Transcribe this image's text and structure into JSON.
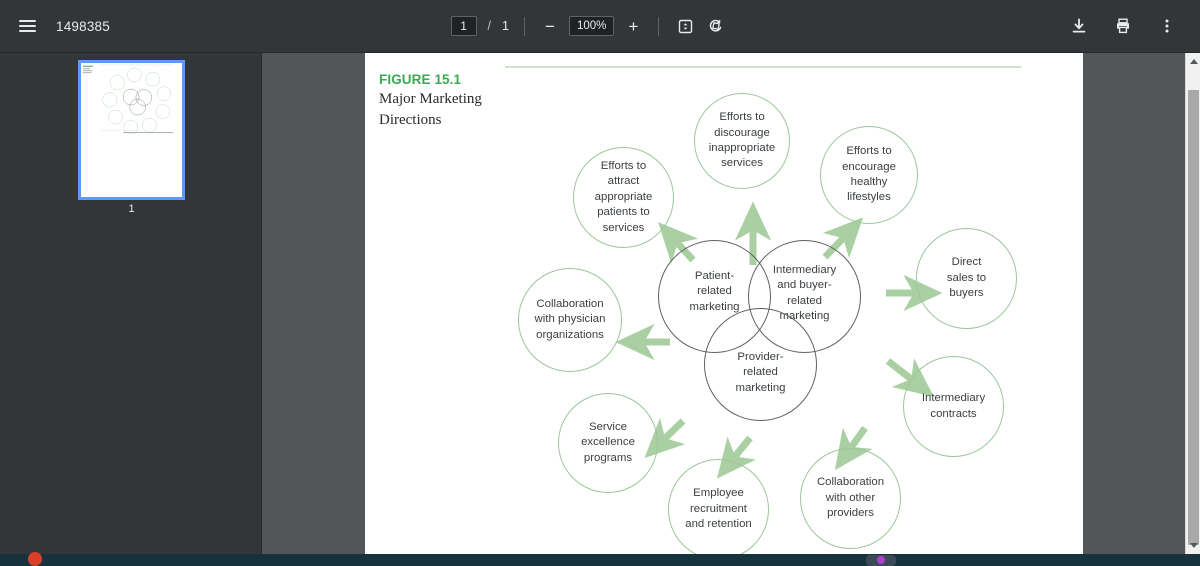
{
  "toolbar": {
    "menu_icon": "hamburger-menu-icon",
    "document_title": "1498385",
    "page_current": "1",
    "page_separator": "/",
    "page_total": "1",
    "zoom_out_label": "−",
    "zoom_level": "100%",
    "zoom_in_label": "+",
    "fit_page_icon": "fit-to-page-icon",
    "rotate_icon": "rotate-counterclockwise-icon",
    "download_icon": "download-icon",
    "print_icon": "print-icon",
    "more_icon": "more-options-icon"
  },
  "sidebar": {
    "thumbnails": [
      {
        "label": "1",
        "selected": true
      }
    ]
  },
  "document": {
    "figure_label": "FIGURE 15.1",
    "figure_title": "Major Marketing Directions",
    "core_circles": [
      {
        "id": "patient",
        "text": "Patient-\nrelated\nmarketing"
      },
      {
        "id": "intermediary",
        "text": "Intermediary\nand buyer-\nrelated\nmarketing"
      },
      {
        "id": "provider",
        "text": "Provider-\nrelated\nmarketing"
      }
    ],
    "outer_circles": [
      {
        "id": "discourage",
        "text": "Efforts to\ndiscourage\ninappropriate\nservices"
      },
      {
        "id": "encourage",
        "text": "Efforts to\nencourage\nhealthy\nlifestyles"
      },
      {
        "id": "attract",
        "text": "Efforts to\nattract\nappropriate\npatients to\nservices"
      },
      {
        "id": "direct-sales",
        "text": "Direct\nsales to\nbuyers"
      },
      {
        "id": "physician-collab",
        "text": "Collaboration\nwith physician\norganizations"
      },
      {
        "id": "intermediary-contracts",
        "text": "Intermediary\ncontracts"
      },
      {
        "id": "service-excellence",
        "text": "Service\nexcellence\nprograms"
      },
      {
        "id": "provider-collab",
        "text": "Collaboration\nwith other\nproviders"
      },
      {
        "id": "employee",
        "text": "Employee\nrecruitment\nand retention"
      }
    ]
  },
  "scrollbar": {
    "up_arrow": "scroll-up-arrow",
    "down_arrow": "scroll-down-arrow"
  },
  "colors": {
    "accent_green": "#3aaa53",
    "circle_green": "#9dc79a",
    "arrow_green": "#a9cfa3",
    "circle_dark": "#5f6163",
    "toolbar_bg": "#323639",
    "viewer_bg": "#525659",
    "selection_blue": "#5a9bf6"
  }
}
